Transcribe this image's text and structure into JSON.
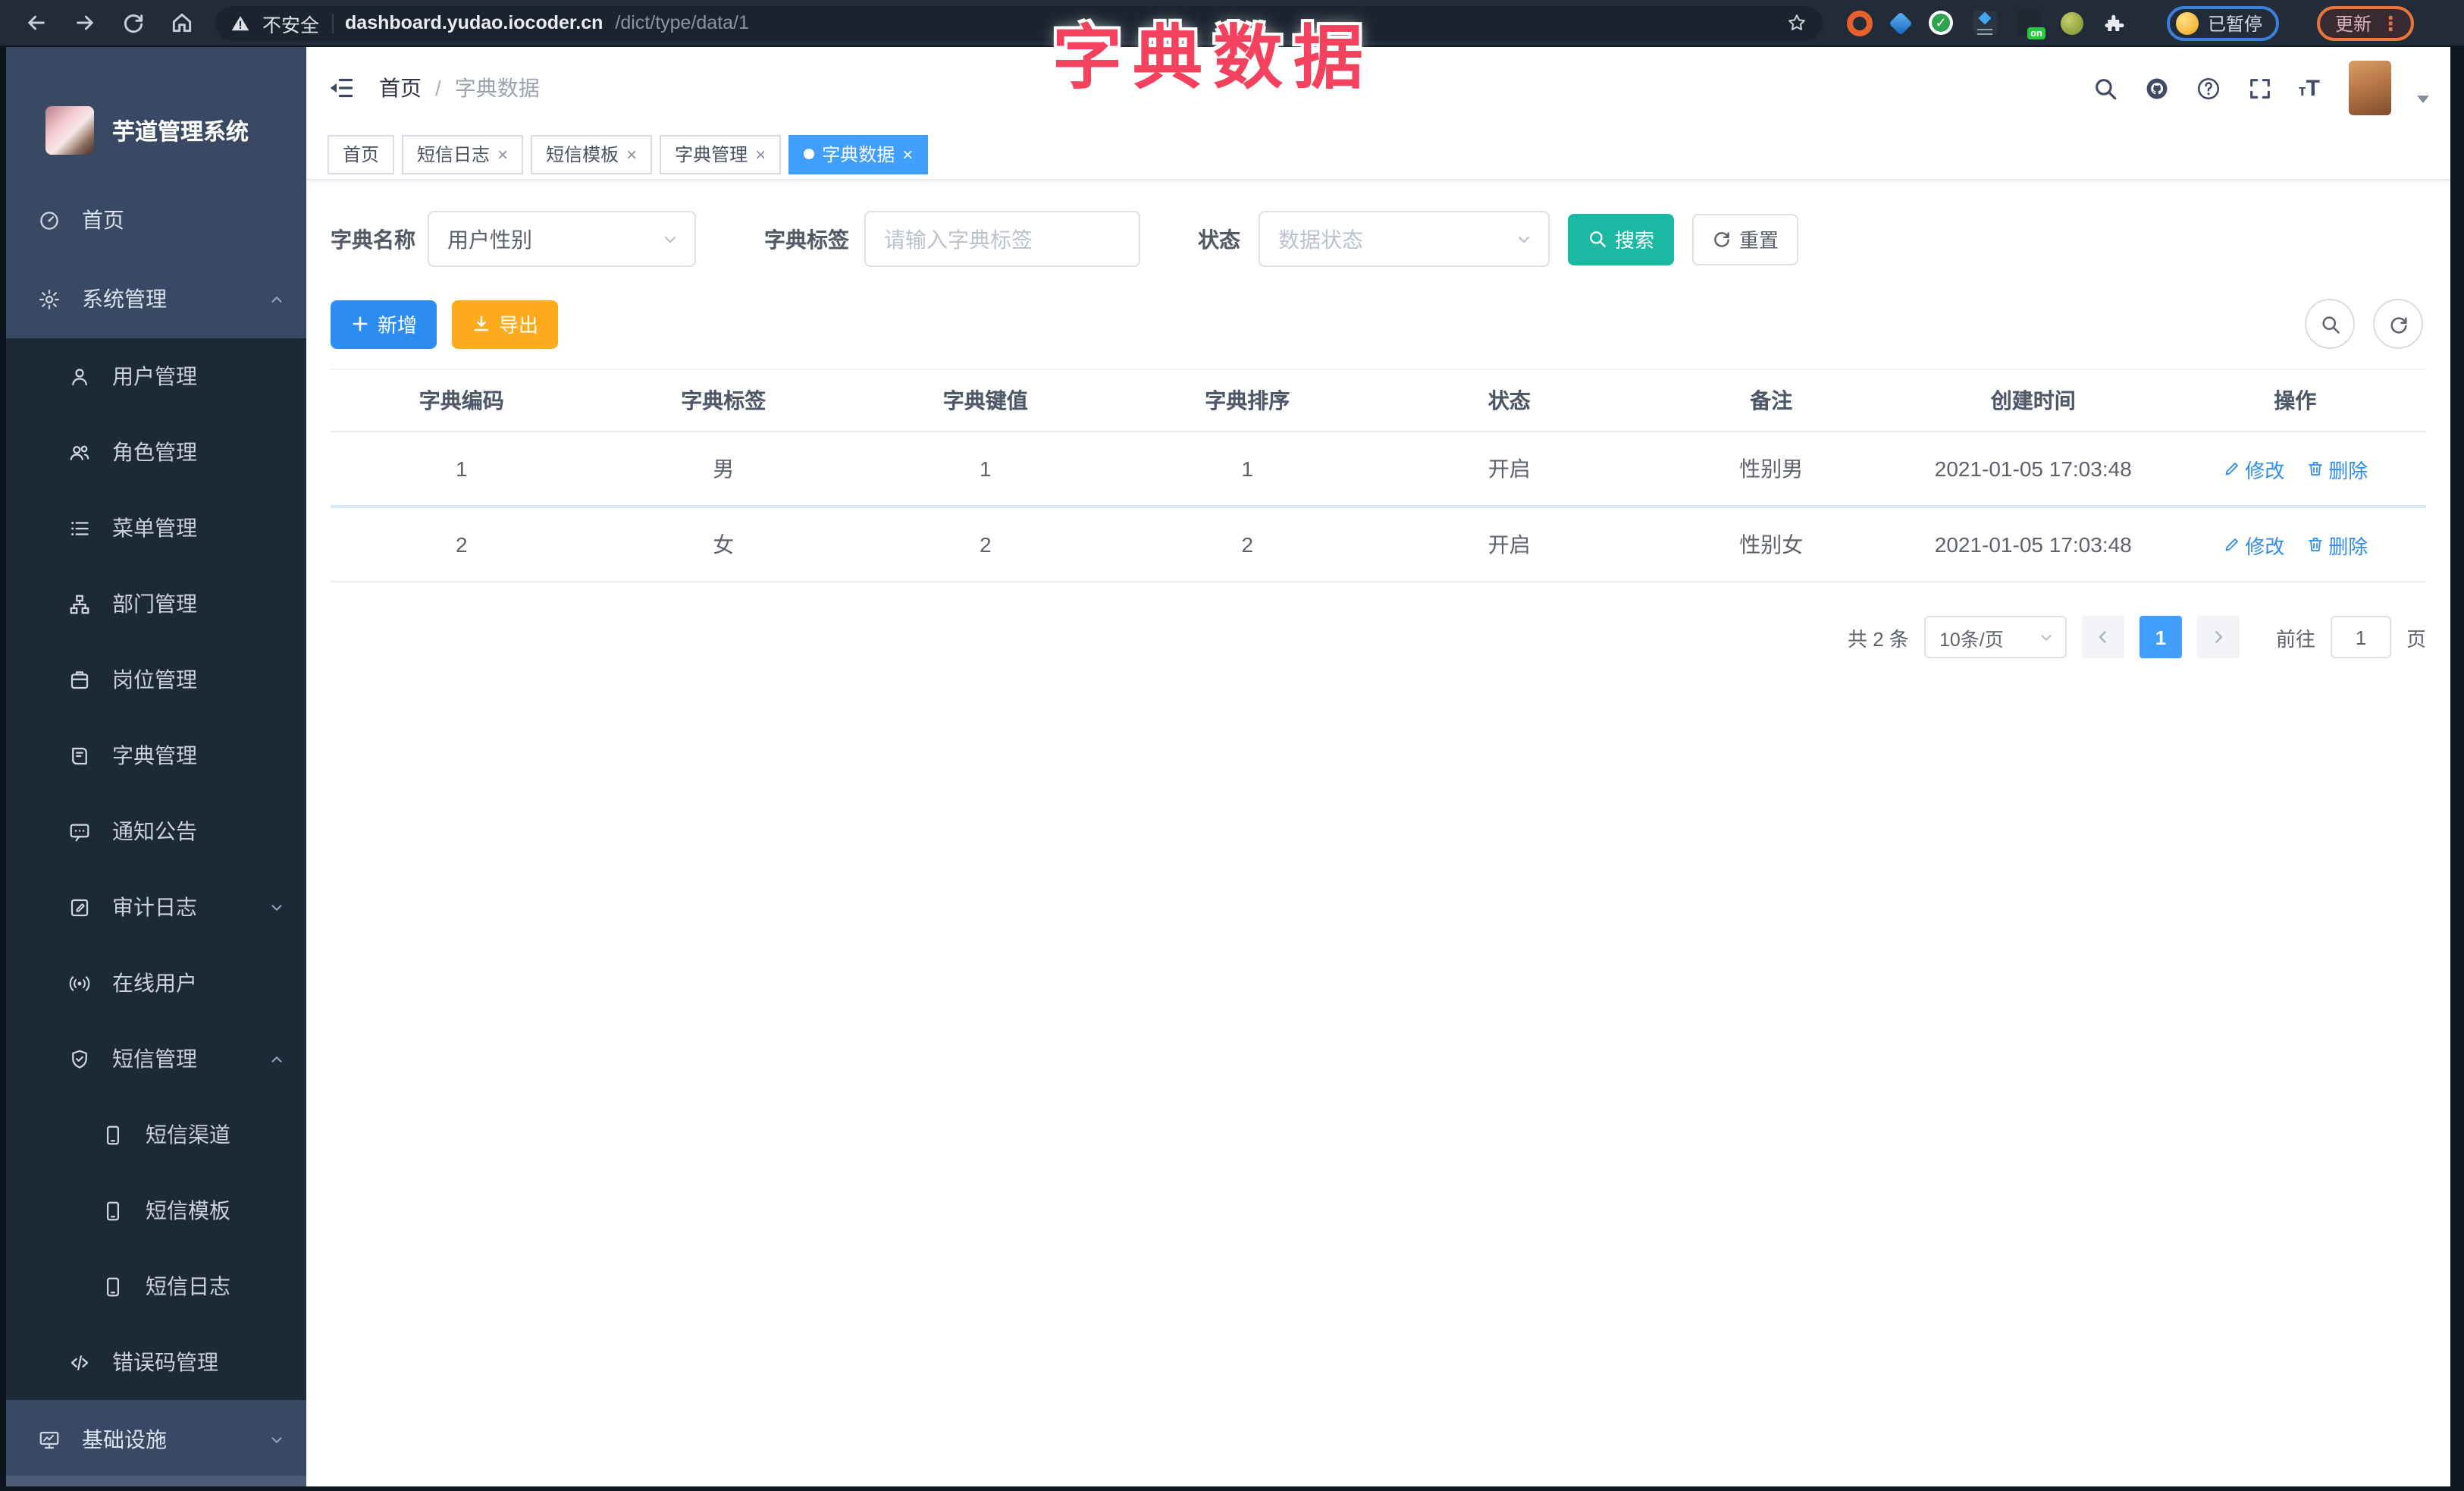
{
  "colors": {
    "browser_bar_bg": "#222c39",
    "sidebar_bg": "#3a4963",
    "submenu_bg": "#1e2938",
    "primary_blue": "#409eff",
    "add_button_blue": "#2c8cf0",
    "export_button_yellow": "#fcab1c",
    "search_button_teal": "#1bb8a2",
    "link_blue": "#2e8cf0",
    "overlay_pink": "#f4415e",
    "update_pill_orange": "#e8763a",
    "paused_pill_blue": "#3d7edb"
  },
  "overlay_title": "字典数据",
  "browser": {
    "security": "不安全",
    "host": "dashboard.yudao.iocoder.cn",
    "path": "/dict/type/data/1",
    "extension_badge": "on",
    "paused": "已暂停",
    "update": "更新"
  },
  "sidebar": {
    "app_title": "芋道管理系统",
    "items": [
      {
        "label": "首页"
      },
      {
        "label": "系统管理"
      },
      {
        "label": "用户管理"
      },
      {
        "label": "角色管理"
      },
      {
        "label": "菜单管理"
      },
      {
        "label": "部门管理"
      },
      {
        "label": "岗位管理"
      },
      {
        "label": "字典管理"
      },
      {
        "label": "通知公告"
      },
      {
        "label": "审计日志"
      },
      {
        "label": "在线用户"
      },
      {
        "label": "短信管理"
      },
      {
        "label": "短信渠道"
      },
      {
        "label": "短信模板"
      },
      {
        "label": "短信日志"
      },
      {
        "label": "错误码管理"
      },
      {
        "label": "基础设施"
      }
    ]
  },
  "navbar": {
    "breadcrumb_home": "首页",
    "separator": "/",
    "breadcrumb_current": "字典数据"
  },
  "tabs": [
    {
      "label": "首页"
    },
    {
      "label": "短信日志"
    },
    {
      "label": "短信模板"
    },
    {
      "label": "字典管理"
    },
    {
      "label": "字典数据"
    }
  ],
  "filters": {
    "name_label": "字典名称",
    "name_value": "用户性别",
    "tag_label": "字典标签",
    "tag_placeholder": "请输入字典标签",
    "status_label": "状态",
    "status_placeholder": "数据状态",
    "search": "搜索",
    "reset": "重置"
  },
  "toolbar": {
    "add": "新增",
    "export": "导出"
  },
  "table": {
    "headers": [
      "字典编码",
      "字典标签",
      "字典键值",
      "字典排序",
      "状态",
      "备注",
      "创建时间",
      "操作"
    ],
    "rows": [
      {
        "cells": [
          "1",
          "男",
          "1",
          "1",
          "开启",
          "性别男",
          "2021-01-05 17:03:48"
        ]
      },
      {
        "cells": [
          "2",
          "女",
          "2",
          "2",
          "开启",
          "性别女",
          "2021-01-05 17:03:48"
        ]
      }
    ],
    "edit": "修改",
    "delete": "删除"
  },
  "pagination": {
    "total": "共 2 条",
    "page_size": "10条/页",
    "page": "1",
    "goto": "前往",
    "goto_value": "1",
    "unit": "页"
  }
}
